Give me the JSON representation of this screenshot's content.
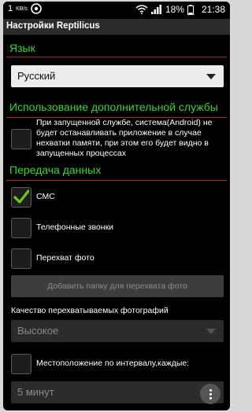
{
  "status": {
    "network": "1",
    "speed": "KB/s",
    "battery": "18%",
    "time": "21:38"
  },
  "app": {
    "title": "Настройки Reptilicus"
  },
  "sections": {
    "language": "Язык",
    "service": "Использование дополнительной службы",
    "transfer": "Передача данных"
  },
  "language_select": {
    "value": "Русский"
  },
  "service_checkbox": {
    "checked": false,
    "text": "При запущенной службе, система(Android) не будет останавливать приложение в случае нехватки памяти, при этом его будет видно в запущенных процессах"
  },
  "transfer": {
    "sms": {
      "label": "СМС",
      "checked": true
    },
    "calls": {
      "label": "Телефонные звонки",
      "checked": false
    },
    "photo": {
      "label": "Перехват фото",
      "checked": false
    },
    "add_folder": "Добавить папку для перехвата фото",
    "quality_label": "Качество перехватываемых фотографий",
    "quality_value": "Высокое",
    "location": {
      "label": "Местоположение по интервалу,каждые:",
      "checked": false
    },
    "interval_value": "5 минут"
  },
  "colors": {
    "accent_green": "#39d62e",
    "divider_red": "#b01e22",
    "check_green": "#6ec61e"
  }
}
